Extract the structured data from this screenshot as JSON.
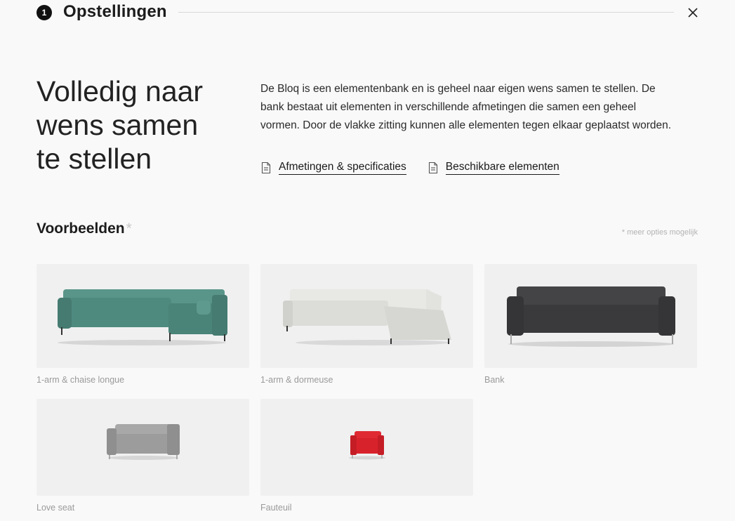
{
  "header": {
    "step_number": "1",
    "title": "Opstellingen"
  },
  "hero": {
    "title_line1": "Volledig naar",
    "title_line2": "wens samen",
    "title_line3": "te stellen",
    "description": "De Bloq is een elementenbank en is geheel naar eigen wens samen te stellen. De bank bestaat uit elementen in verschillende afmetingen die samen een geheel vormen. Door de vlakke zitting kunnen alle elementen tegen elkaar geplaatst worden."
  },
  "links": [
    {
      "label": "Afmetingen & specificaties",
      "icon": "document-icon"
    },
    {
      "label": "Beschikbare elementen",
      "icon": "document-icon"
    }
  ],
  "examples": {
    "title": "Voorbeelden",
    "asterisk": "*",
    "note": "* meer opties mogelijk",
    "items": [
      {
        "caption": "1-arm & chaise longue",
        "color": "#4f8a7f"
      },
      {
        "caption": "1-arm & dormeuse",
        "color": "#dcdcd8"
      },
      {
        "caption": "Bank",
        "color": "#3a3a3c"
      },
      {
        "caption": "Love seat",
        "color": "#9c9c9c"
      },
      {
        "caption": "Fauteuil",
        "color": "#d8222b"
      }
    ]
  }
}
